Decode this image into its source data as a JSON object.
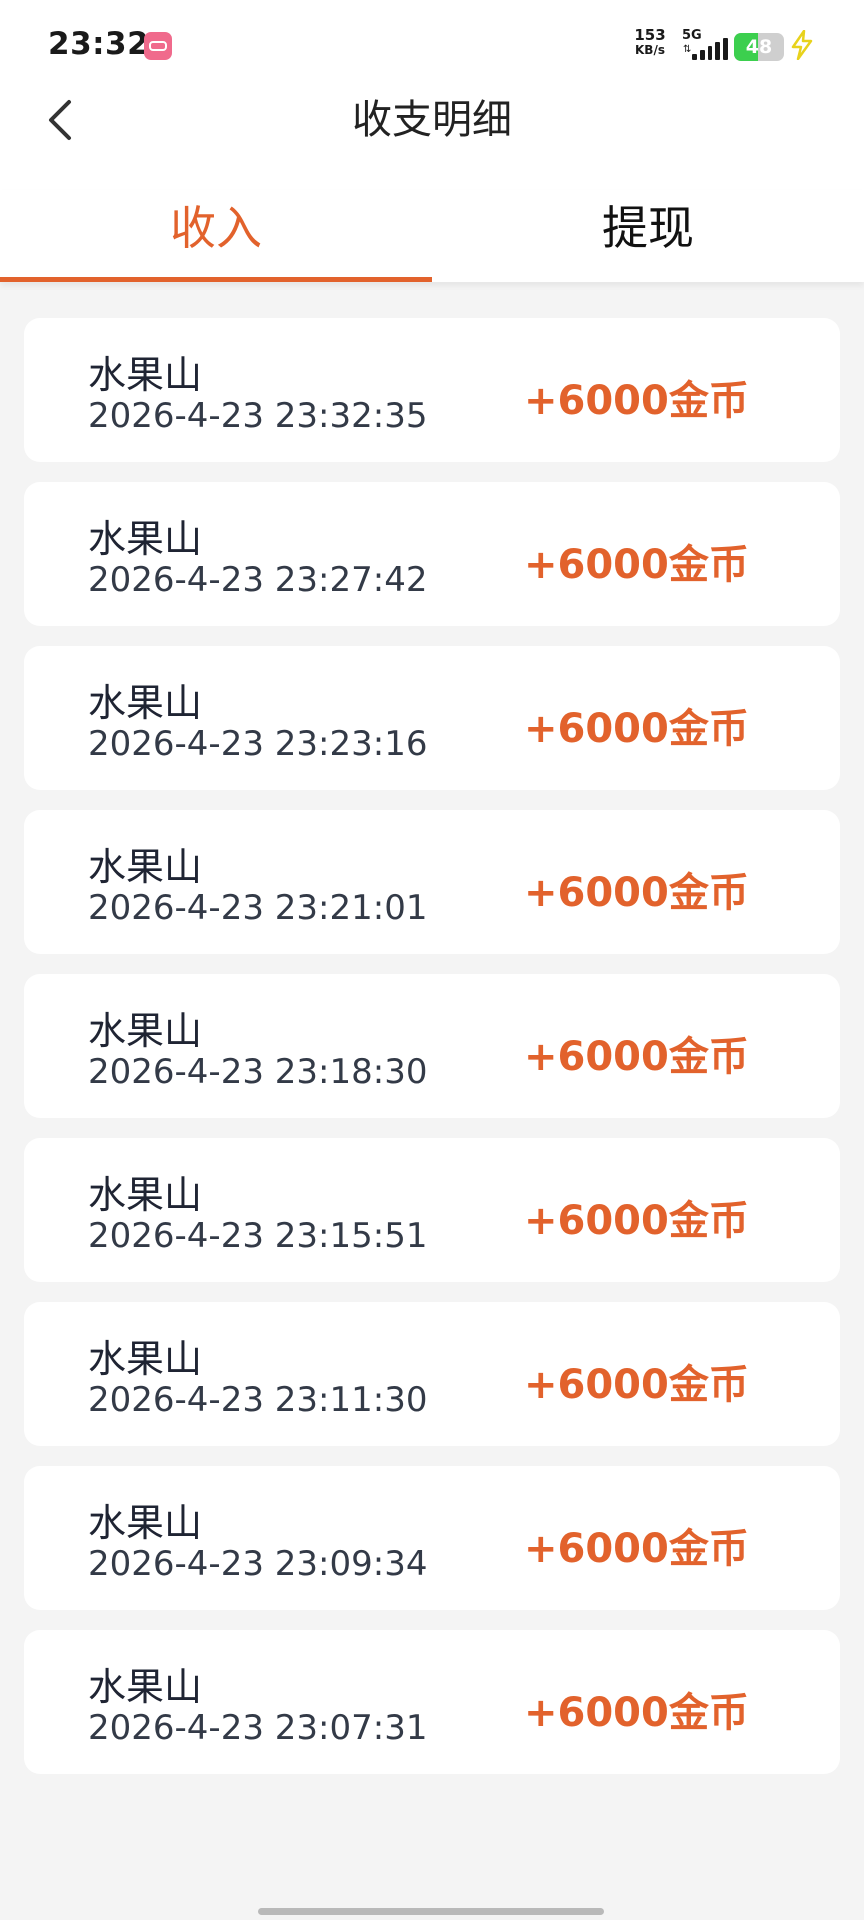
{
  "status_bar": {
    "time": "23:32",
    "app_icon": "bilibili-icon",
    "net_speed_value": "153",
    "net_speed_unit": "KB/s",
    "network_type": "5G",
    "battery_level": "48",
    "battery_level_fraction": 0.48,
    "charging_icon": "lightning-icon"
  },
  "header": {
    "back_icon": "chevron-left-icon",
    "title": "收支明细"
  },
  "tabs": [
    {
      "label": "收入",
      "active": true
    },
    {
      "label": "提现",
      "active": false
    }
  ],
  "records": [
    {
      "name": "水果山",
      "time": "2026-4-23 23:32:35",
      "amount": "+6000金币"
    },
    {
      "name": "水果山",
      "time": "2026-4-23 23:27:42",
      "amount": "+6000金币"
    },
    {
      "name": "水果山",
      "time": "2026-4-23 23:23:16",
      "amount": "+6000金币"
    },
    {
      "name": "水果山",
      "time": "2026-4-23 23:21:01",
      "amount": "+6000金币"
    },
    {
      "name": "水果山",
      "time": "2026-4-23 23:18:30",
      "amount": "+6000金币"
    },
    {
      "name": "水果山",
      "time": "2026-4-23 23:15:51",
      "amount": "+6000金币"
    },
    {
      "name": "水果山",
      "time": "2026-4-23 23:11:30",
      "amount": "+6000金币"
    },
    {
      "name": "水果山",
      "time": "2026-4-23 23:09:34",
      "amount": "+6000金币"
    },
    {
      "name": "水果山",
      "time": "2026-4-23 23:07:31",
      "amount": "+6000金币"
    }
  ],
  "colors": {
    "accent": "#e2622c",
    "background": "#f4f4f4",
    "battery_green": "#3ccf4e"
  }
}
